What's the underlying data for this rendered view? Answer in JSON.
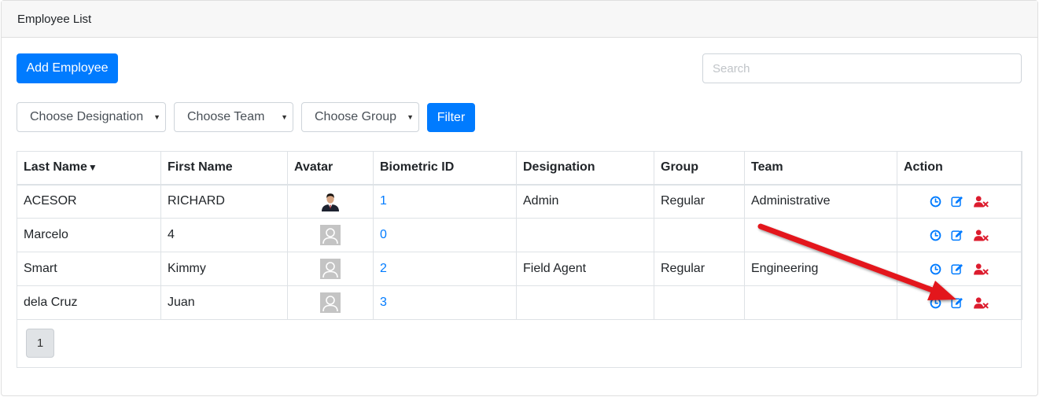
{
  "header": {
    "title": "Employee List"
  },
  "toolbar": {
    "add_label": "Add Employee",
    "search_placeholder": "Search",
    "filter_label": "Filter"
  },
  "filters": {
    "designation": "Choose Designation",
    "team": "Choose Team",
    "group": "Choose Group"
  },
  "table": {
    "columns": [
      "Last Name",
      "First Name",
      "Avatar",
      "Biometric ID",
      "Designation",
      "Group",
      "Team",
      "Action"
    ],
    "rows": [
      {
        "last_name": "ACESOR",
        "first_name": "RICHARD",
        "avatar": "photo",
        "biometric_id": "1",
        "designation": "Admin",
        "group": "Regular",
        "team": "Administrative"
      },
      {
        "last_name": "Marcelo",
        "first_name": "4",
        "avatar": "default-avatar-icon",
        "biometric_id": "0",
        "designation": "",
        "group": "",
        "team": ""
      },
      {
        "last_name": "Smart",
        "first_name": "Kimmy",
        "avatar": "default-avatar-icon",
        "biometric_id": "2",
        "designation": "Field Agent",
        "group": "Regular",
        "team": "Engineering"
      },
      {
        "last_name": "dela Cruz",
        "first_name": "Juan",
        "avatar": "default-avatar-icon",
        "biometric_id": "3",
        "designation": "",
        "group": "",
        "team": ""
      }
    ],
    "action_icons": [
      "clock-icon",
      "edit-icon",
      "user-remove-icon"
    ]
  },
  "pagination": {
    "current_page": "1"
  },
  "colors": {
    "primary": "#007bff",
    "danger": "#dc1c2e",
    "annotation_arrow": "#e3141b"
  }
}
